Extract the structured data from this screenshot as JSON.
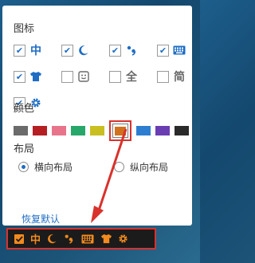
{
  "section_icons": {
    "title": "图标"
  },
  "icons": [
    {
      "name": "zhong-chinese",
      "checked": true,
      "glyph": "中",
      "kind": "text"
    },
    {
      "name": "moon",
      "checked": true,
      "kind": "svg"
    },
    {
      "name": "punctuation",
      "checked": true,
      "kind": "svg"
    },
    {
      "name": "keyboard",
      "checked": true,
      "kind": "svg"
    },
    {
      "name": "tshirt-skin",
      "checked": true,
      "kind": "svg"
    },
    {
      "name": "emoticon",
      "checked": false,
      "kind": "svg"
    },
    {
      "name": "quan-fullwidth",
      "checked": false,
      "glyph": "全",
      "kind": "text"
    },
    {
      "name": "jian-simplified",
      "checked": false,
      "glyph": "简",
      "kind": "text"
    },
    {
      "name": "gear-settings",
      "checked": true,
      "kind": "svg"
    }
  ],
  "section_colors": {
    "title": "颜色"
  },
  "colors": [
    "#6b6b6b",
    "#b51f24",
    "#e8748c",
    "#27a86a",
    "#c9bf21",
    "#d0711e",
    "#2d7ed1",
    "#6b3db3",
    "#2a2a2a"
  ],
  "selected_color_index": 5,
  "section_layout": {
    "title": "布局"
  },
  "layout": {
    "horizontal_label": "横向布局",
    "vertical_label": "纵向布局",
    "selected": "horizontal"
  },
  "restore_default": "恢复默认",
  "toolbar": {
    "accent": "#f28a1e",
    "zhong": "中"
  }
}
